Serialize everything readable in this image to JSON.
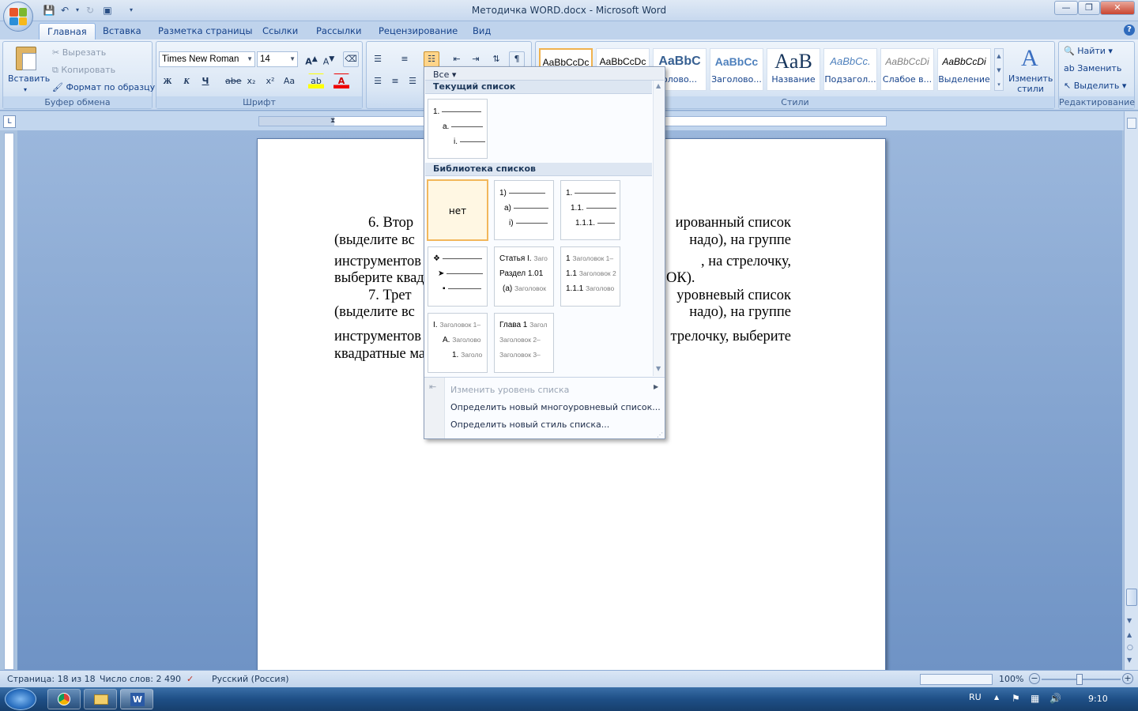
{
  "window": {
    "title": "Методичка WORD.docx - Microsoft Word"
  },
  "tabs": [
    "Главная",
    "Вставка",
    "Разметка страницы",
    "Ссылки",
    "Рассылки",
    "Рецензирование",
    "Вид"
  ],
  "clipboard": {
    "paste": "Вставить",
    "cut": "Вырезать",
    "copy": "Копировать",
    "format_painter": "Формат по образцу",
    "label": "Буфер обмена"
  },
  "font": {
    "name": "Times New Roman",
    "size": "14",
    "label": "Шрифт",
    "bold": "Ж",
    "italic": "К",
    "underline": "Ч",
    "strike": "abe",
    "sub": "x₂",
    "sup": "x²",
    "case": "Aa"
  },
  "styles": {
    "label": "Стили",
    "items": [
      {
        "sample": "AaBbCcDc",
        "name": ""
      },
      {
        "sample": "AaBbCcDc",
        "name": ""
      },
      {
        "sample": "AaBbC",
        "name": "оловo..."
      },
      {
        "sample": "AaBbCc",
        "name": "Заголово..."
      },
      {
        "sample": "AaB",
        "name": "Название"
      },
      {
        "sample": "AaBbCc.",
        "name": "Подзагол..."
      },
      {
        "sample": "AaBbCcDi",
        "name": "Слабое в..."
      },
      {
        "sample": "AaBbCcDi",
        "name": "Выделение"
      }
    ],
    "change": "Изменить стили"
  },
  "editing": {
    "find": "Найти",
    "replace": "Заменить",
    "select": "Выделить",
    "label": "Редактирование"
  },
  "dropdown": {
    "filter": "Все",
    "current_header": "Текущий список",
    "library_header": "Библиотека списков",
    "none_label": "нет",
    "current_tile": [
      "1.",
      "a.",
      "i."
    ],
    "tile_numbered": [
      "1)",
      "a)",
      "i)"
    ],
    "tile_decimal": [
      "1.",
      "1.1.",
      "1.1.1."
    ],
    "tile_article": [
      "Статья I.",
      "Заго",
      "Раздел 1.01",
      "(a)",
      "Заголовок"
    ],
    "tile_heading_num": [
      "1",
      "Заголовок 1–",
      "1.1",
      "Заголовок 2",
      "1.1.1",
      "Заголово"
    ],
    "tile_roman": [
      "I.",
      "Заголовок 1–",
      "A.",
      "Заголово",
      "1.",
      "Заголо"
    ],
    "tile_chapter": [
      "Глава 1",
      "Загол",
      "Заголовок 2–",
      "Заголовок 3–"
    ],
    "change_level": "Изменить уровень списка",
    "define_multilevel": "Определить новый многоуровневый список...",
    "define_style": "Определить новый стиль списка..."
  },
  "document": {
    "lines": [
      "6.   Втор",
      "ированный   список",
      "(выделите   вс",
      "надо),   на   группе",
      "инструментов",
      ",   на   стрелочку,",
      "выберите квад",
      "ОК).",
      "7.   Трет",
      "уровневый   список",
      "(выделите   вс",
      "надо),   на   группе",
      "инструментов",
      "трелочку, выберите",
      "квадратные ма"
    ]
  },
  "status": {
    "page": "Страница: 18 из 18",
    "words": "Число слов: 2 490",
    "lang": "Русский (Россия)",
    "zoom": "100%"
  },
  "taskbar": {
    "lang": "RU",
    "time": "9:10"
  }
}
